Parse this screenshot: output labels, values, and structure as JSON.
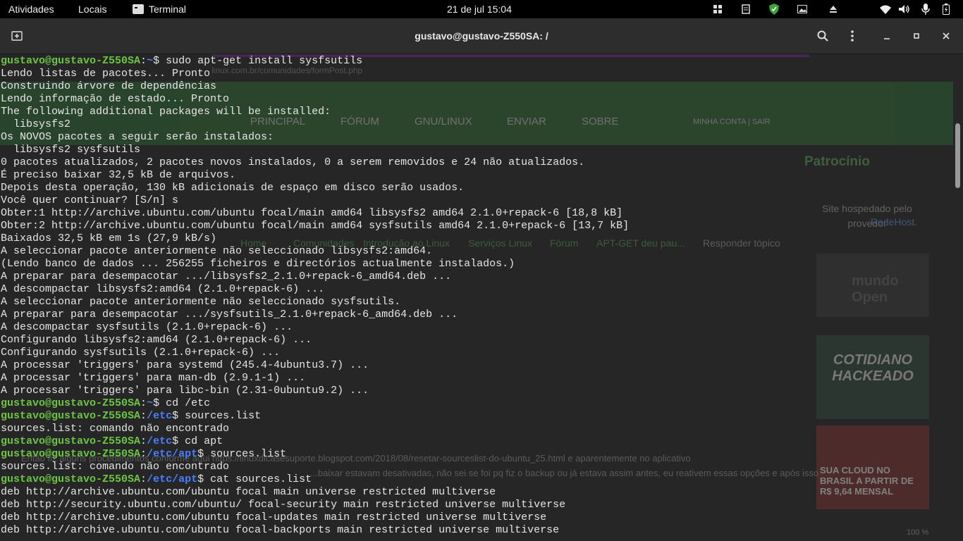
{
  "topbar": {
    "activities": "Atividades",
    "places": "Locais",
    "app_name": "Terminal",
    "clock": "21 de jul  15:04"
  },
  "window": {
    "title": "gustavo@gustavo-Z550SA: /"
  },
  "terminal": {
    "user_host": "gustavo@gustavo-Z550SA",
    "lines": [
      {
        "type": "prompt",
        "path": "~",
        "cmd": "sudo apt-get install sysfsutils"
      },
      {
        "type": "out",
        "text": "Lendo listas de pacotes... Pronto"
      },
      {
        "type": "out",
        "text": "Construindo árvore de dependências"
      },
      {
        "type": "out",
        "text": "Lendo informação de estado... Pronto"
      },
      {
        "type": "out",
        "text": "The following additional packages will be installed:"
      },
      {
        "type": "out",
        "text": "  libsysfs2"
      },
      {
        "type": "out",
        "text": "Os NOVOS pacotes a seguir serão instalados:"
      },
      {
        "type": "out",
        "text": "  libsysfs2 sysfsutils"
      },
      {
        "type": "out",
        "text": "0 pacotes atualizados, 2 pacotes novos instalados, 0 a serem removidos e 24 não atualizados."
      },
      {
        "type": "out",
        "text": "É preciso baixar 32,5 kB de arquivos."
      },
      {
        "type": "out",
        "text": "Depois desta operação, 130 kB adicionais de espaço em disco serão usados."
      },
      {
        "type": "out",
        "text": "Você quer continuar? [S/n] s"
      },
      {
        "type": "out",
        "text": "Obter:1 http://archive.ubuntu.com/ubuntu focal/main amd64 libsysfs2 amd64 2.1.0+repack-6 [18,8 kB]"
      },
      {
        "type": "out",
        "text": "Obter:2 http://archive.ubuntu.com/ubuntu focal/main amd64 sysfsutils amd64 2.1.0+repack-6 [13,7 kB]"
      },
      {
        "type": "out",
        "text": "Baixados 32,5 kB em 1s (27,9 kB/s)"
      },
      {
        "type": "out",
        "text": "A seleccionar pacote anteriormente não seleccionado libsysfs2:amd64."
      },
      {
        "type": "out",
        "text": "(Lendo banco de dados ... 256255 ficheiros e directórios actualmente instalados.)"
      },
      {
        "type": "out",
        "text": "A preparar para desempacotar .../libsysfs2_2.1.0+repack-6_amd64.deb ..."
      },
      {
        "type": "out",
        "text": "A descompactar libsysfs2:amd64 (2.1.0+repack-6) ..."
      },
      {
        "type": "out",
        "text": "A seleccionar pacote anteriormente não seleccionado sysfsutils."
      },
      {
        "type": "out",
        "text": "A preparar para desempacotar .../sysfsutils_2.1.0+repack-6_amd64.deb ..."
      },
      {
        "type": "out",
        "text": "A descompactar sysfsutils (2.1.0+repack-6) ..."
      },
      {
        "type": "out",
        "text": "Configurando libsysfs2:amd64 (2.1.0+repack-6) ..."
      },
      {
        "type": "out",
        "text": "Configurando sysfsutils (2.1.0+repack-6) ..."
      },
      {
        "type": "out",
        "text": "A processar 'triggers' para systemd (245.4-4ubuntu3.7) ..."
      },
      {
        "type": "out",
        "text": "A processar 'triggers' para man-db (2.9.1-1) ..."
      },
      {
        "type": "out",
        "text": "A processar 'triggers' para libc-bin (2.31-0ubuntu9.2) ..."
      },
      {
        "type": "prompt",
        "path": "~",
        "cmd": "cd /etc"
      },
      {
        "type": "prompt",
        "path": "/etc",
        "cmd": "sources.list"
      },
      {
        "type": "out",
        "text": "sources.list: comando não encontrado"
      },
      {
        "type": "prompt",
        "path": "/etc",
        "cmd": "cd apt"
      },
      {
        "type": "prompt",
        "path": "/etc/apt",
        "cmd": "sources.list"
      },
      {
        "type": "out",
        "text": "sources.list: comando não encontrado"
      },
      {
        "type": "prompt",
        "path": "/etc/apt",
        "cmd": "cat sources.list"
      },
      {
        "type": "out",
        "text": "deb http://archive.ubuntu.com/ubuntu focal main universe restricted multiverse"
      },
      {
        "type": "out",
        "text": "deb http://security.ubuntu.com/ubuntu/ focal-security main restricted universe multiverse"
      },
      {
        "type": "out",
        "text": "deb http://archive.ubuntu.com/ubuntu focal-updates main restricted universe multiverse"
      },
      {
        "type": "out",
        "text": "deb http://archive.ubuntu.com/ubuntu focal-backports main restricted universe multiverse"
      }
    ]
  },
  "background_window": {
    "url_fragment": "linux.com.br/comunidades/formPost.php",
    "nav": [
      "PRINCIPAL",
      "FÓRUM",
      "GNU/LINUX",
      "ENVIAR",
      "SOBRE"
    ],
    "account": "MINHA CONTA |  SAIR",
    "sidebar_title": "Patrocínio",
    "sponsor_text": "Site hospedado pelo provedor",
    "sponsor_link": "RedeHost.",
    "breadcrumb": [
      "Home",
      "Comunidades",
      "Introdução ao Linux",
      "Serviços Linux",
      "Fórum",
      "APT-GET deu pau...",
      "Responder tópico"
    ],
    "ad_open": "mundo Open",
    "ad_cotidiano": "COTIDIANO HACKEADO",
    "ad_cloud": "SUA CLOUD NO BRASIL A PARTIR DE R$ 9,64 MENSAL",
    "post_line1": "Então fiz alguns procedimentos conforme aqui https://linuxdicasesuporte.blogspot.com/2018/08/resetar-sourceslist-do-ubuntu_25.html e aparentemente no aplicativo",
    "post_line2": "...baixar estavam desativadas, não sei se foi pq fiz o backup ou já estava assim antes, eu reativem essas opções e após isso",
    "zoom": "100 %"
  },
  "colors": {
    "prompt_user": "#6cc644",
    "prompt_path": "#4a80ff",
    "terminal_bg": "#262626",
    "titlebar_bg": "#2d2d2d",
    "topbar_bg": "#000000"
  }
}
